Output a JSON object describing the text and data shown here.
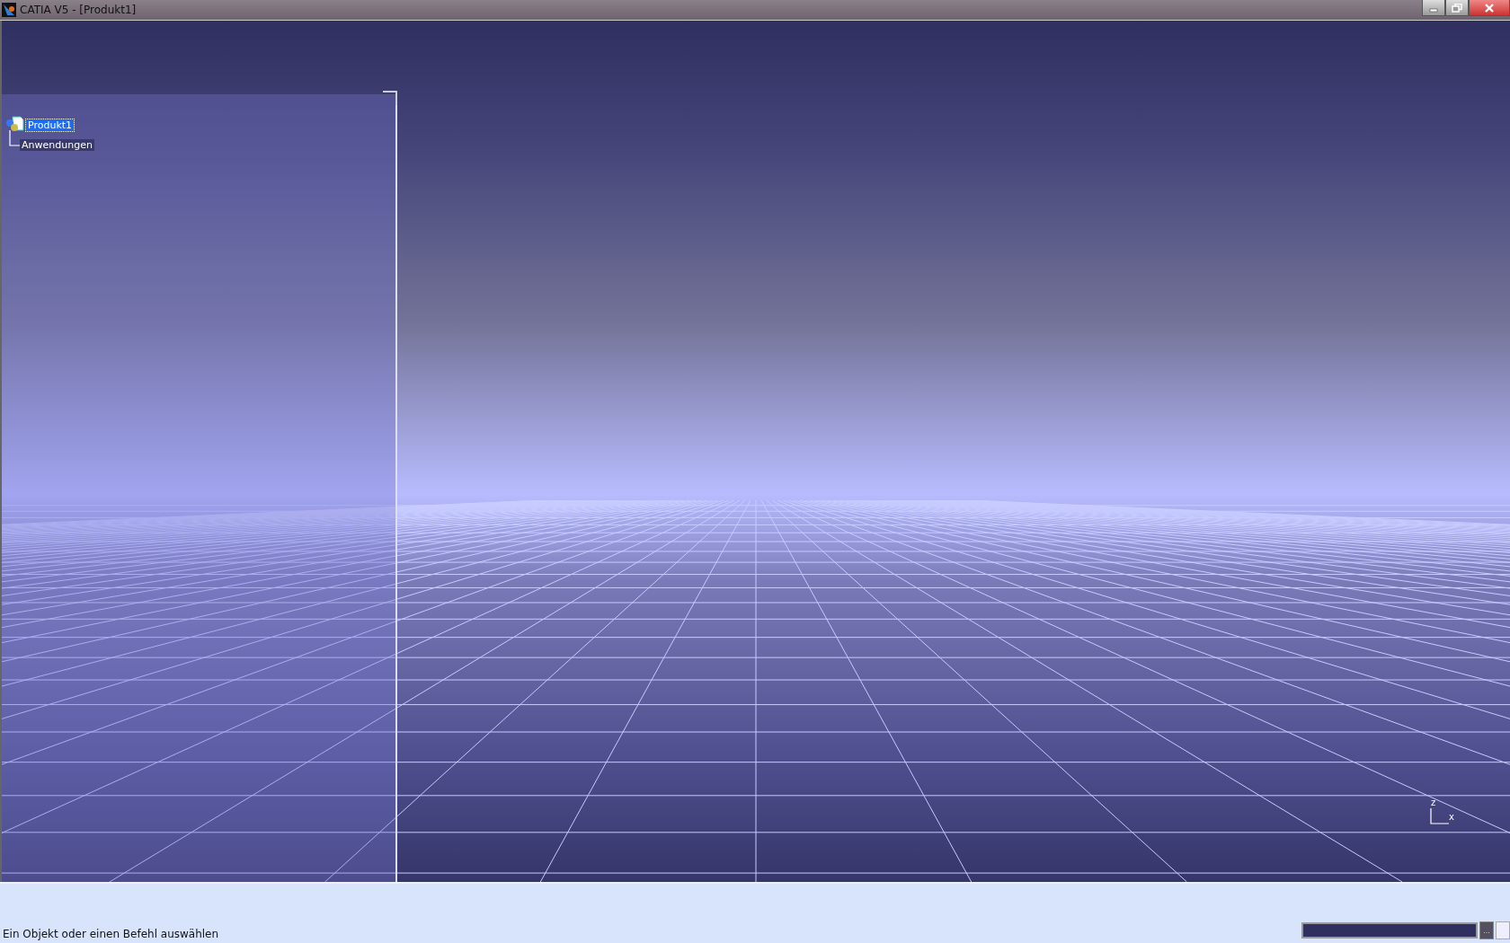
{
  "window": {
    "title": "CATIA V5 - [Produkt1]"
  },
  "tree": [
    {
      "label": "Produkt1",
      "selected": true,
      "children": [
        {
          "label": "Anwendungen",
          "selected": false
        }
      ]
    }
  ],
  "axis": {
    "z_label": "z",
    "x_label": "x"
  },
  "status_bar": {
    "message": "Ein Objekt oder einen Befehl auswählen",
    "more_button": "..."
  }
}
